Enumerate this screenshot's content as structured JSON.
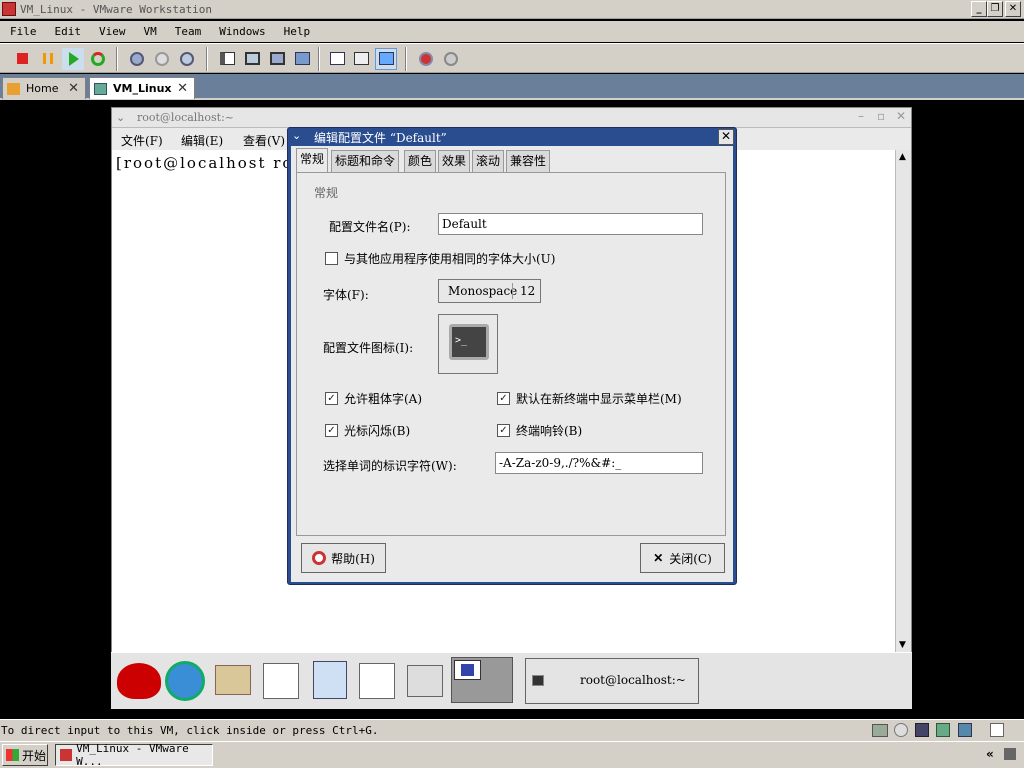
{
  "vmware": {
    "title": "VM_Linux - VMware Workstation",
    "menu": [
      "File",
      "Edit",
      "View",
      "VM",
      "Team",
      "Windows",
      "Help"
    ],
    "tabs": [
      {
        "label": "Home"
      },
      {
        "label": "VM_Linux"
      }
    ],
    "status_text": "To direct input to this VM, click inside or press Ctrl+G."
  },
  "terminal": {
    "title": "root@localhost:~",
    "menu": [
      "文件(F)",
      "编辑(E)",
      "查看(V)"
    ],
    "prompt": "[root@localhost roo"
  },
  "dialog": {
    "title": "编辑配置文件 “Default”",
    "tabs": [
      "常规",
      "标题和命令",
      "颜色",
      "效果",
      "滚动",
      "兼容性"
    ],
    "section": "常规",
    "profile_name_label": "配置文件名(P):",
    "profile_name_value": "Default",
    "same_font_label": "与其他应用程序使用相同的字体大小(U)",
    "font_label": "字体(F):",
    "font_name": "Monospace",
    "font_size": "12",
    "icon_label": "配置文件图标(I):",
    "allow_bold_label": "允许粗体字(A)",
    "show_menubar_label": "默认在新终端中显示菜单栏(M)",
    "cursor_blink_label": "光标闪烁(B)",
    "bell_label": "终端响铃(B)",
    "word_chars_label": "选择单词的标识字符(W):",
    "word_chars_value": "-A-Za-z0-9,./?%&#:_",
    "help_button": "帮助(H)",
    "close_button": "关闭(C)",
    "checks": {
      "same_font": false,
      "allow_bold": true,
      "show_menubar": true,
      "cursor_blink": true,
      "bell": true
    }
  },
  "gnome_panel": {
    "window_button": "root@localhost:~"
  },
  "taskbar": {
    "start": "开始",
    "task": "VM_Linux - VMware W..."
  }
}
